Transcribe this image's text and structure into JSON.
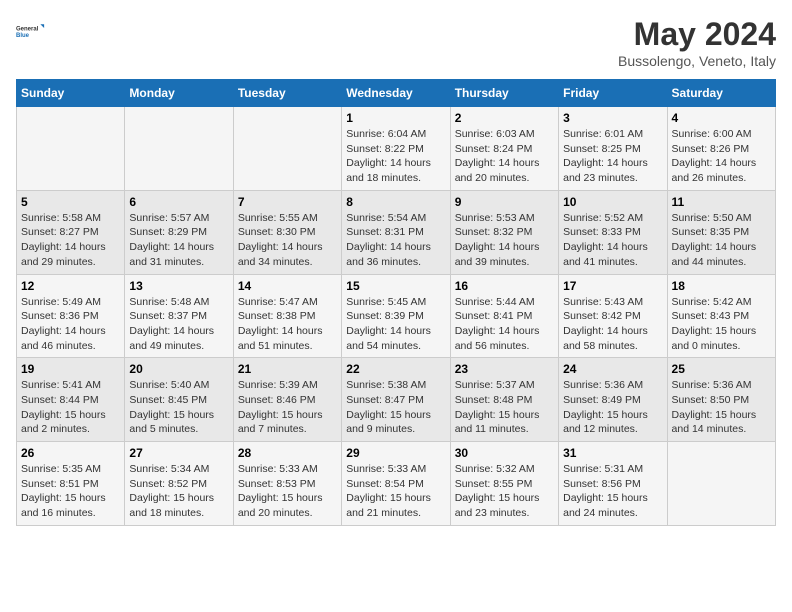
{
  "logo": {
    "line1": "General",
    "line2": "Blue"
  },
  "title": "May 2024",
  "subtitle": "Bussolengo, Veneto, Italy",
  "header_days": [
    "Sunday",
    "Monday",
    "Tuesday",
    "Wednesday",
    "Thursday",
    "Friday",
    "Saturday"
  ],
  "weeks": [
    [
      {
        "day": "",
        "info": ""
      },
      {
        "day": "",
        "info": ""
      },
      {
        "day": "",
        "info": ""
      },
      {
        "day": "1",
        "info": "Sunrise: 6:04 AM\nSunset: 8:22 PM\nDaylight: 14 hours\nand 18 minutes."
      },
      {
        "day": "2",
        "info": "Sunrise: 6:03 AM\nSunset: 8:24 PM\nDaylight: 14 hours\nand 20 minutes."
      },
      {
        "day": "3",
        "info": "Sunrise: 6:01 AM\nSunset: 8:25 PM\nDaylight: 14 hours\nand 23 minutes."
      },
      {
        "day": "4",
        "info": "Sunrise: 6:00 AM\nSunset: 8:26 PM\nDaylight: 14 hours\nand 26 minutes."
      }
    ],
    [
      {
        "day": "5",
        "info": "Sunrise: 5:58 AM\nSunset: 8:27 PM\nDaylight: 14 hours\nand 29 minutes."
      },
      {
        "day": "6",
        "info": "Sunrise: 5:57 AM\nSunset: 8:29 PM\nDaylight: 14 hours\nand 31 minutes."
      },
      {
        "day": "7",
        "info": "Sunrise: 5:55 AM\nSunset: 8:30 PM\nDaylight: 14 hours\nand 34 minutes."
      },
      {
        "day": "8",
        "info": "Sunrise: 5:54 AM\nSunset: 8:31 PM\nDaylight: 14 hours\nand 36 minutes."
      },
      {
        "day": "9",
        "info": "Sunrise: 5:53 AM\nSunset: 8:32 PM\nDaylight: 14 hours\nand 39 minutes."
      },
      {
        "day": "10",
        "info": "Sunrise: 5:52 AM\nSunset: 8:33 PM\nDaylight: 14 hours\nand 41 minutes."
      },
      {
        "day": "11",
        "info": "Sunrise: 5:50 AM\nSunset: 8:35 PM\nDaylight: 14 hours\nand 44 minutes."
      }
    ],
    [
      {
        "day": "12",
        "info": "Sunrise: 5:49 AM\nSunset: 8:36 PM\nDaylight: 14 hours\nand 46 minutes."
      },
      {
        "day": "13",
        "info": "Sunrise: 5:48 AM\nSunset: 8:37 PM\nDaylight: 14 hours\nand 49 minutes."
      },
      {
        "day": "14",
        "info": "Sunrise: 5:47 AM\nSunset: 8:38 PM\nDaylight: 14 hours\nand 51 minutes."
      },
      {
        "day": "15",
        "info": "Sunrise: 5:45 AM\nSunset: 8:39 PM\nDaylight: 14 hours\nand 54 minutes."
      },
      {
        "day": "16",
        "info": "Sunrise: 5:44 AM\nSunset: 8:41 PM\nDaylight: 14 hours\nand 56 minutes."
      },
      {
        "day": "17",
        "info": "Sunrise: 5:43 AM\nSunset: 8:42 PM\nDaylight: 14 hours\nand 58 minutes."
      },
      {
        "day": "18",
        "info": "Sunrise: 5:42 AM\nSunset: 8:43 PM\nDaylight: 15 hours\nand 0 minutes."
      }
    ],
    [
      {
        "day": "19",
        "info": "Sunrise: 5:41 AM\nSunset: 8:44 PM\nDaylight: 15 hours\nand 2 minutes."
      },
      {
        "day": "20",
        "info": "Sunrise: 5:40 AM\nSunset: 8:45 PM\nDaylight: 15 hours\nand 5 minutes."
      },
      {
        "day": "21",
        "info": "Sunrise: 5:39 AM\nSunset: 8:46 PM\nDaylight: 15 hours\nand 7 minutes."
      },
      {
        "day": "22",
        "info": "Sunrise: 5:38 AM\nSunset: 8:47 PM\nDaylight: 15 hours\nand 9 minutes."
      },
      {
        "day": "23",
        "info": "Sunrise: 5:37 AM\nSunset: 8:48 PM\nDaylight: 15 hours\nand 11 minutes."
      },
      {
        "day": "24",
        "info": "Sunrise: 5:36 AM\nSunset: 8:49 PM\nDaylight: 15 hours\nand 12 minutes."
      },
      {
        "day": "25",
        "info": "Sunrise: 5:36 AM\nSunset: 8:50 PM\nDaylight: 15 hours\nand 14 minutes."
      }
    ],
    [
      {
        "day": "26",
        "info": "Sunrise: 5:35 AM\nSunset: 8:51 PM\nDaylight: 15 hours\nand 16 minutes."
      },
      {
        "day": "27",
        "info": "Sunrise: 5:34 AM\nSunset: 8:52 PM\nDaylight: 15 hours\nand 18 minutes."
      },
      {
        "day": "28",
        "info": "Sunrise: 5:33 AM\nSunset: 8:53 PM\nDaylight: 15 hours\nand 20 minutes."
      },
      {
        "day": "29",
        "info": "Sunrise: 5:33 AM\nSunset: 8:54 PM\nDaylight: 15 hours\nand 21 minutes."
      },
      {
        "day": "30",
        "info": "Sunrise: 5:32 AM\nSunset: 8:55 PM\nDaylight: 15 hours\nand 23 minutes."
      },
      {
        "day": "31",
        "info": "Sunrise: 5:31 AM\nSunset: 8:56 PM\nDaylight: 15 hours\nand 24 minutes."
      },
      {
        "day": "",
        "info": ""
      }
    ]
  ]
}
